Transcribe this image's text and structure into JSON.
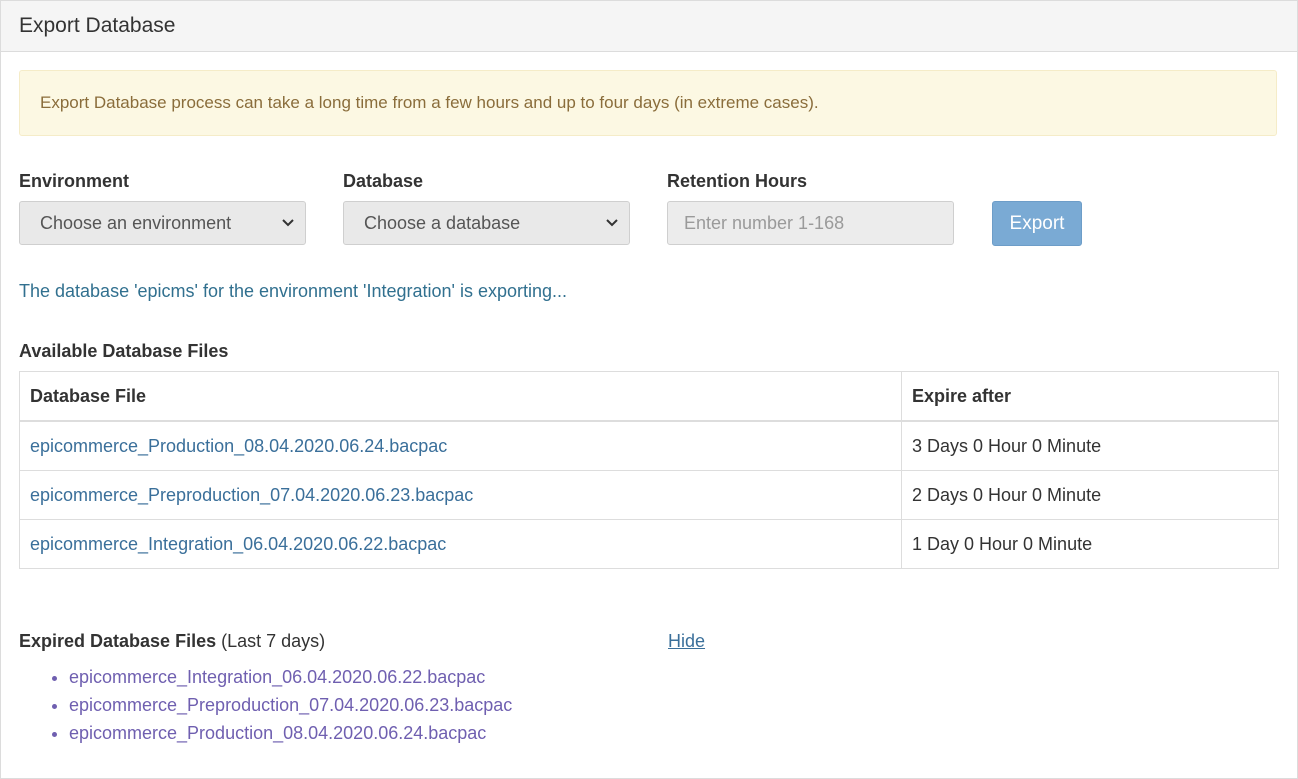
{
  "header": {
    "title": "Export Database"
  },
  "alert": {
    "text": "Export Database process can take a long time from a few hours and up to four days (in extreme cases)."
  },
  "form": {
    "environment_label": "Environment",
    "environment_value": "Choose an environment",
    "database_label": "Database",
    "database_value": "Choose a database",
    "retention_label": "Retention Hours",
    "retention_placeholder": "Enter number 1-168",
    "export_label": "Export"
  },
  "status": {
    "text": "The database 'epicms' for the environment 'Integration' is exporting..."
  },
  "available": {
    "title": "Available Database Files",
    "columns": [
      "Database File",
      "Expire after"
    ],
    "rows": [
      {
        "file": "epicommerce_Production_08.04.2020.06.24.bacpac",
        "expire": "3 Days 0 Hour 0 Minute"
      },
      {
        "file": "epicommerce_Preproduction_07.04.2020.06.23.bacpac",
        "expire": "2 Days 0 Hour 0 Minute"
      },
      {
        "file": "epicommerce_Integration_06.04.2020.06.22.bacpac",
        "expire": "1 Day 0 Hour 0 Minute"
      }
    ]
  },
  "expired": {
    "title": "Expired Database Files",
    "subtitle": "(Last 7 days)",
    "hide_label": "Hide",
    "items": [
      "epicommerce_Integration_06.04.2020.06.22.bacpac",
      "epicommerce_Preproduction_07.04.2020.06.23.bacpac",
      "epicommerce_Production_08.04.2020.06.24.bacpac"
    ]
  },
  "colors": {
    "alert_bg": "#fcf8e3",
    "alert_text": "#8a6d3b",
    "link": "#3a6f9a",
    "visited_link": "#6f5fb0",
    "export_button": "#7aaad4"
  },
  "icons": {
    "select_caret": "chevron-down-icon"
  }
}
